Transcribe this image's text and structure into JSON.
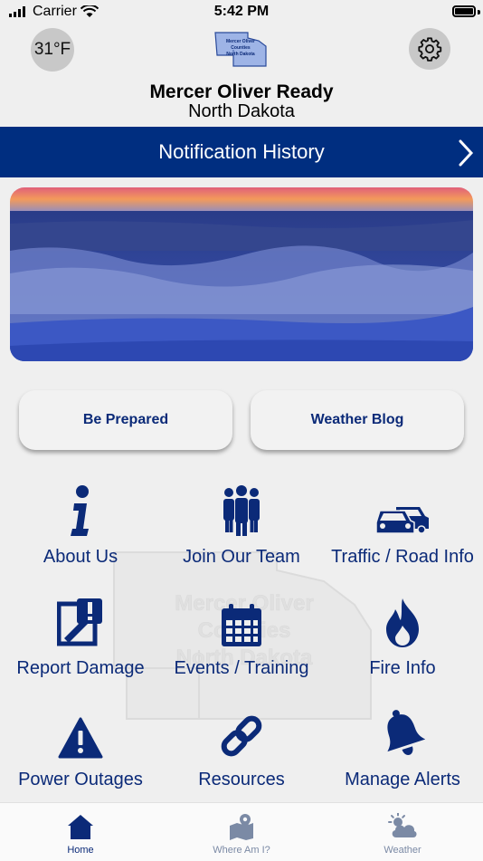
{
  "status_bar": {
    "carrier": "Carrier",
    "time": "5:42 PM"
  },
  "header": {
    "temperature": "31°F",
    "logo_text": [
      "Mercer Oliver",
      "Counties",
      "North Dakota"
    ],
    "title": "Mercer Oliver Ready",
    "subtitle": "North Dakota"
  },
  "notification_bar": {
    "label": "Notification History"
  },
  "buttons": {
    "be_prepared": "Be Prepared",
    "weather_blog": "Weather Blog"
  },
  "watermark": {
    "lines": [
      "Mercer Oliver",
      "Counties",
      "North Dakota"
    ]
  },
  "grid": [
    {
      "label": "About Us",
      "icon": "info-icon"
    },
    {
      "label": "Join Our Team",
      "icon": "users-icon"
    },
    {
      "label": "Traffic / Road Info",
      "icon": "cars-icon"
    },
    {
      "label": "Report Damage",
      "icon": "report-damage-icon"
    },
    {
      "label": "Events / Training",
      "icon": "calendar-icon"
    },
    {
      "label": "Fire Info",
      "icon": "fire-icon"
    },
    {
      "label": "Power Outages",
      "icon": "warning-icon"
    },
    {
      "label": "Resources",
      "icon": "link-icon"
    },
    {
      "label": "Manage Alerts",
      "icon": "bell-icon"
    }
  ],
  "tabs": [
    {
      "label": "Home",
      "icon": "home-icon",
      "active": true
    },
    {
      "label": "Where Am I?",
      "icon": "map-icon",
      "active": false
    },
    {
      "label": "Weather",
      "icon": "weather-icon",
      "active": false
    }
  ],
  "colors": {
    "primary": "#002e80",
    "background": "#efefef"
  }
}
